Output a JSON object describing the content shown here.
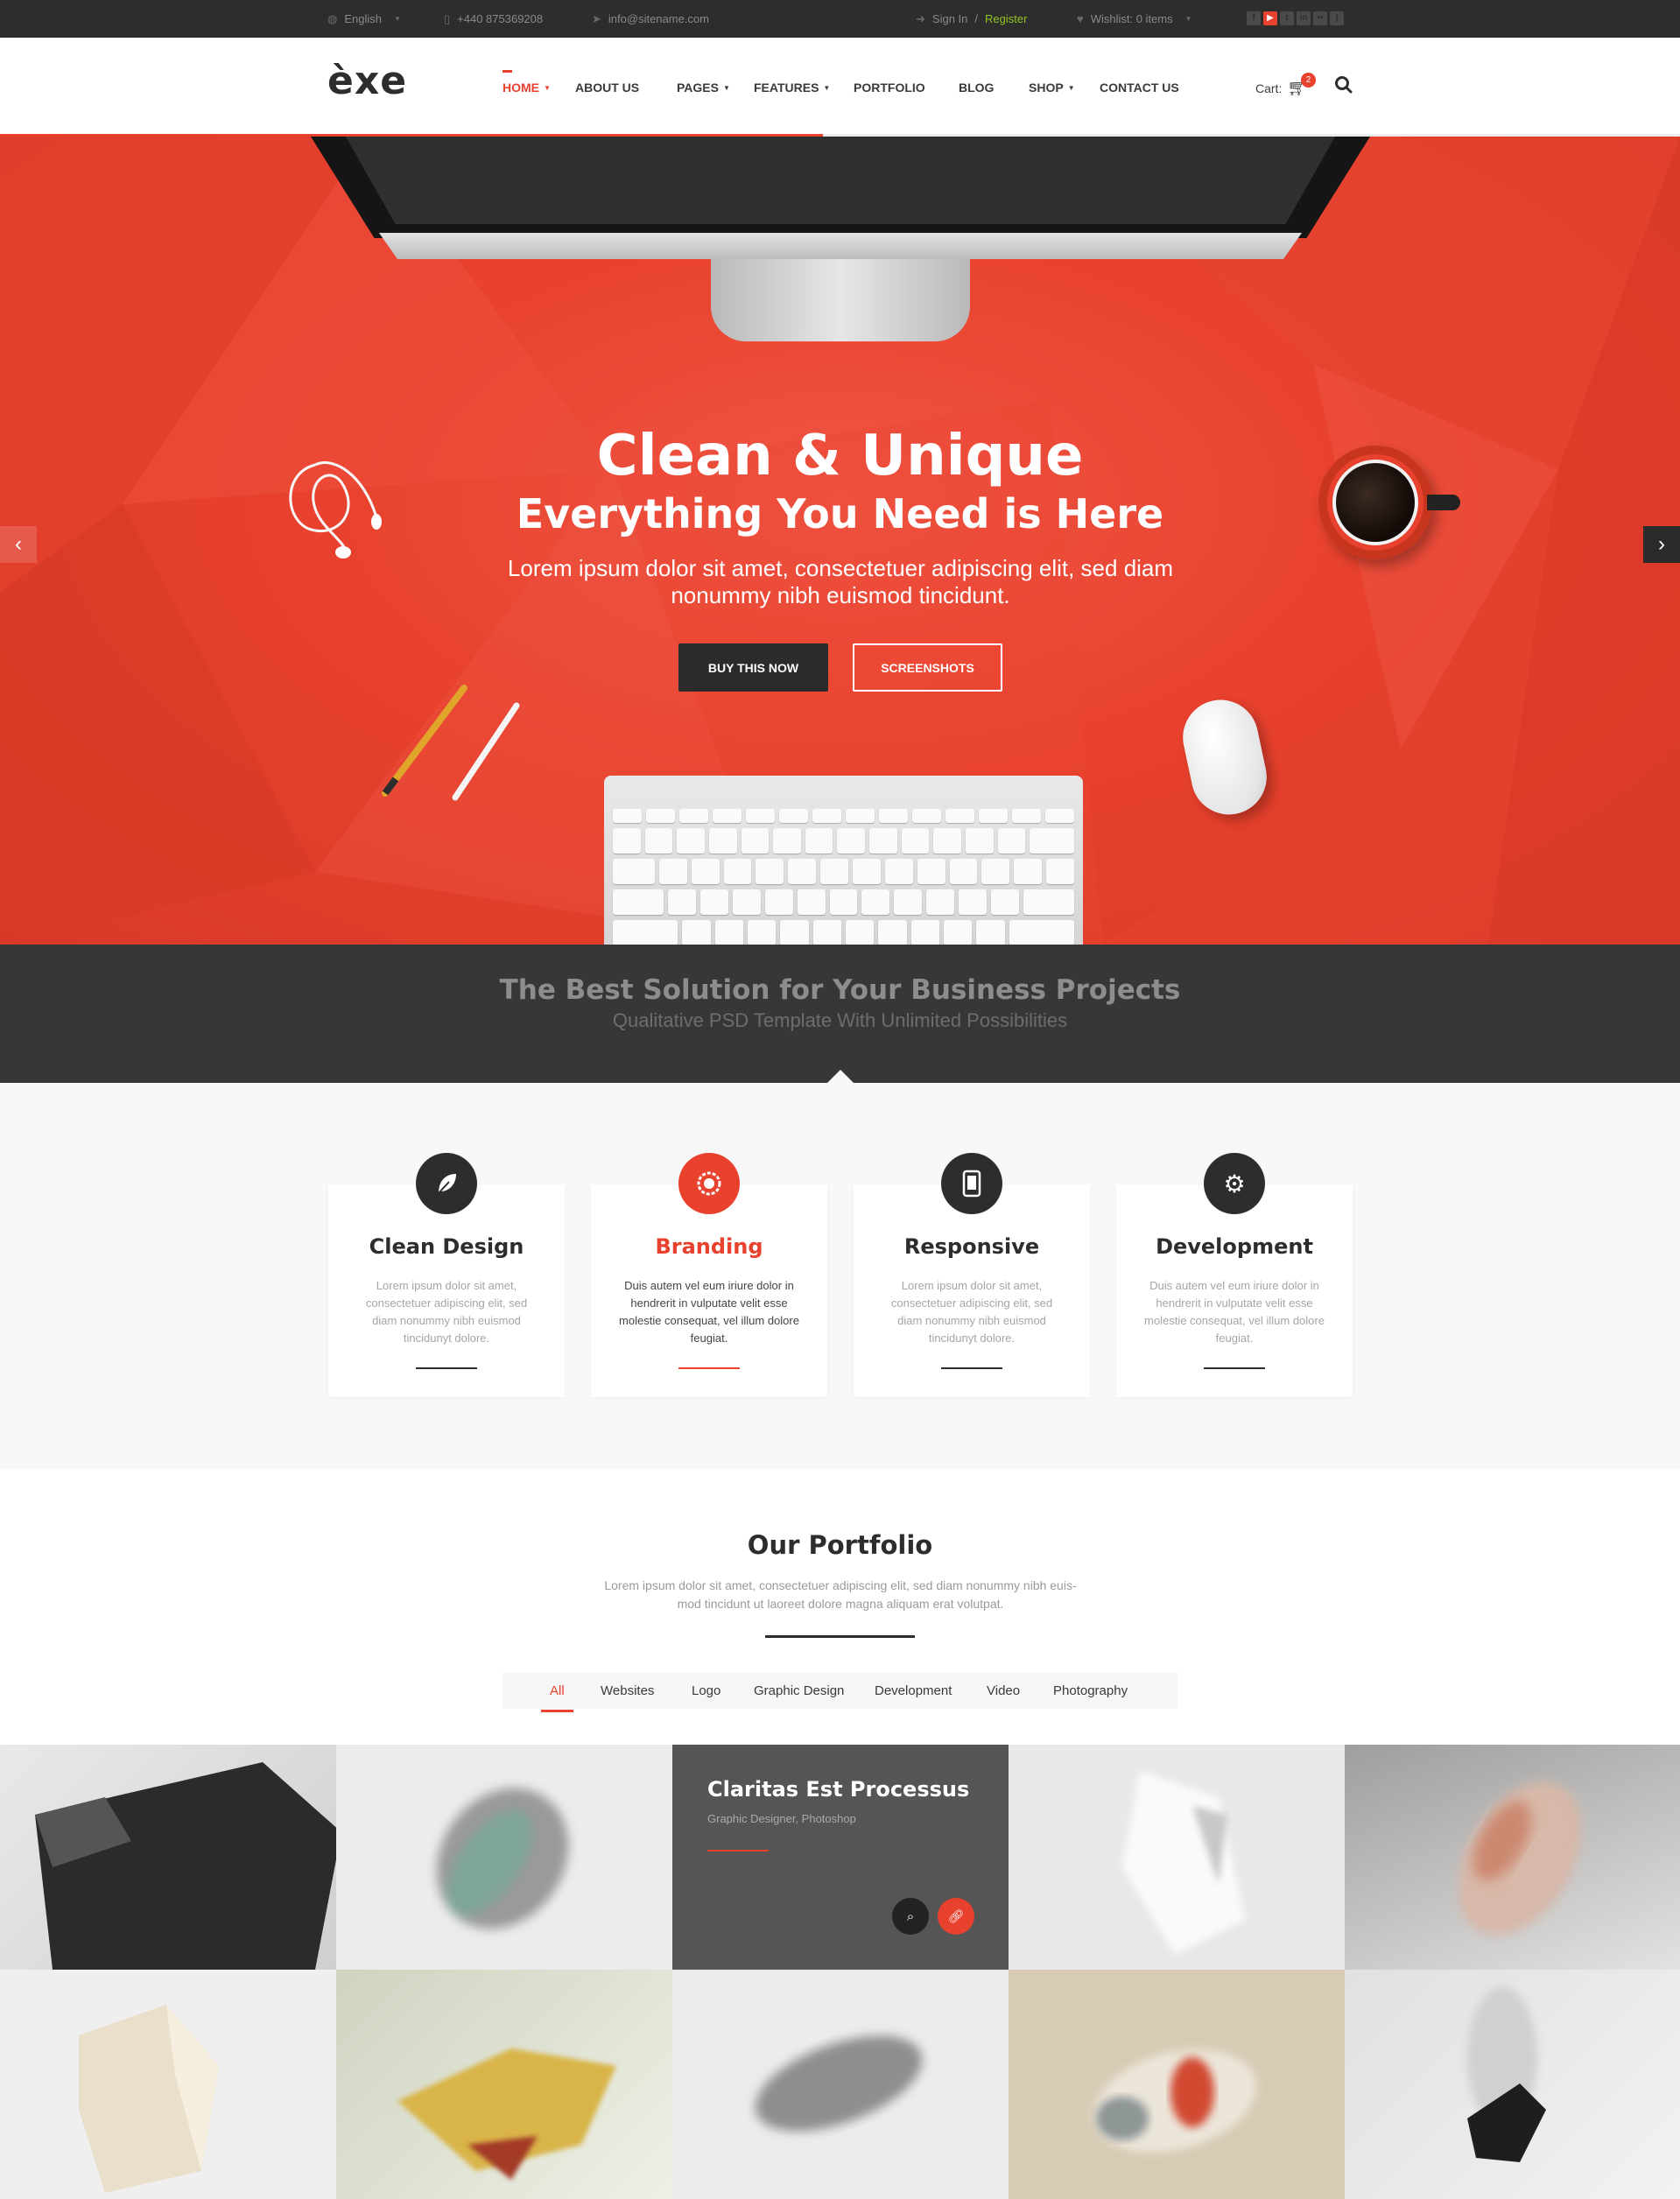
{
  "topbar": {
    "language": "English",
    "phone": "+440 875369208",
    "email": "info@sitename.com",
    "signin": "Sign In",
    "separator": "/",
    "register": "Register",
    "wishlist": "Wishlist: 0 items",
    "social_icons": [
      "facebook-icon",
      "youtube-icon",
      "twitter-icon",
      "linkedin-icon",
      "flickr-icon",
      "rss-icon"
    ],
    "colors": {
      "register": "#8fc31f",
      "active_social": "#e8412d"
    }
  },
  "header": {
    "logo": "èxe",
    "nav": [
      {
        "label": "HOME",
        "dropdown": true,
        "active": true
      },
      {
        "label": "ABOUT US",
        "dropdown": false
      },
      {
        "label": "PAGES",
        "dropdown": true
      },
      {
        "label": "FEATURES",
        "dropdown": true
      },
      {
        "label": "PORTFOLIO",
        "dropdown": false
      },
      {
        "label": "BLOG",
        "dropdown": false
      },
      {
        "label": "SHOP",
        "dropdown": true
      },
      {
        "label": "CONTACT US",
        "dropdown": false
      }
    ],
    "cart_label": "Cart:",
    "cart_count": "2",
    "slider_progress": 0.49
  },
  "hero": {
    "title": "Clean & Unique",
    "subtitle": "Everything You Need is Here",
    "description": "Lorem ipsum dolor sit amet, consectetuer adipiscing elit, sed diam nonummy nibh euismod tincidunt.",
    "buy_button": "BUY THIS NOW",
    "screenshots_button": "SCREENSHOTS",
    "accent": "#e8412d"
  },
  "band": {
    "title": "The Best Solution for Your Business Projects",
    "subtitle": "Qualitative PSD Template With Unlimited Possibilities"
  },
  "features": [
    {
      "icon": "leaf-icon",
      "title": "Clean Design",
      "text": "Lorem ipsum dolor sit amet, consectetuer adipiscing elit, sed diam nonummy nibh euismod tincidunyt dolore.",
      "highlight": false
    },
    {
      "icon": "badge-icon",
      "title": "Branding",
      "text": "Duis autem vel eum iriure dolor in hendrerit in vulputate velit esse molestie consequat, vel illum dolore feugiat.",
      "highlight": true
    },
    {
      "icon": "tablet-icon",
      "title": "Responsive",
      "text": "Lorem ipsum dolor sit amet, consectetuer adipiscing elit, sed diam nonummy nibh euismod tincidunyt dolore.",
      "highlight": false
    },
    {
      "icon": "gear-icon",
      "title": "Development",
      "text": "Duis autem vel eum iriure dolor in hendrerit in vulputate velit esse molestie consequat, vel illum dolore feugiat.",
      "highlight": false
    }
  ],
  "portfolio": {
    "title": "Our Portfolio",
    "description": "Lorem ipsum dolor sit amet, consectetuer adipiscing elit, sed diam nonummy nibh euis- mod tincidunt ut laoreet dolore magna aliquam erat volutpat.",
    "filters": [
      "All",
      "Websites",
      "Logo",
      "Graphic Design",
      "Development",
      "Video",
      "Photography"
    ],
    "active_filter": "All",
    "hover_item": {
      "title": "Claritas Est Processus",
      "subtitle": "Graphic Designer, Photoshop"
    }
  }
}
